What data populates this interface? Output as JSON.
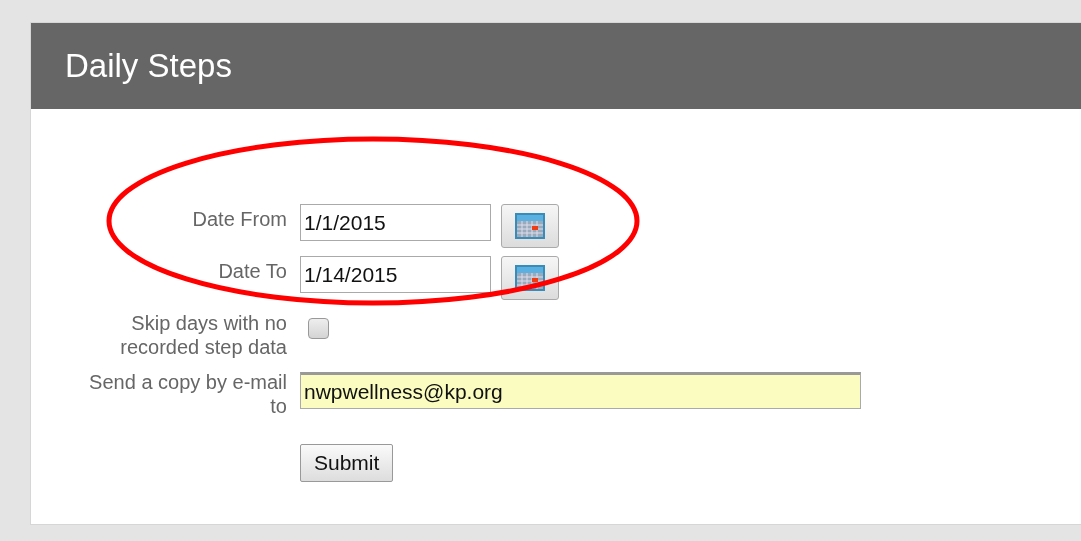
{
  "panel": {
    "title": "Daily Steps"
  },
  "fields": [
    {
      "kind": "date",
      "label": "Date From",
      "value": "1/1/2015"
    },
    {
      "kind": "date",
      "label": "Date To",
      "value": "1/14/2015"
    },
    {
      "kind": "checkbox",
      "label": "Skip days with no recorded step data",
      "checked": false
    },
    {
      "kind": "email",
      "label": "Send a copy by e-mail to",
      "value": "nwpwellness@kp.org"
    }
  ],
  "submit": {
    "label": "Submit"
  },
  "annotation": {
    "kind": "ellipse",
    "color": "#ff0000"
  }
}
